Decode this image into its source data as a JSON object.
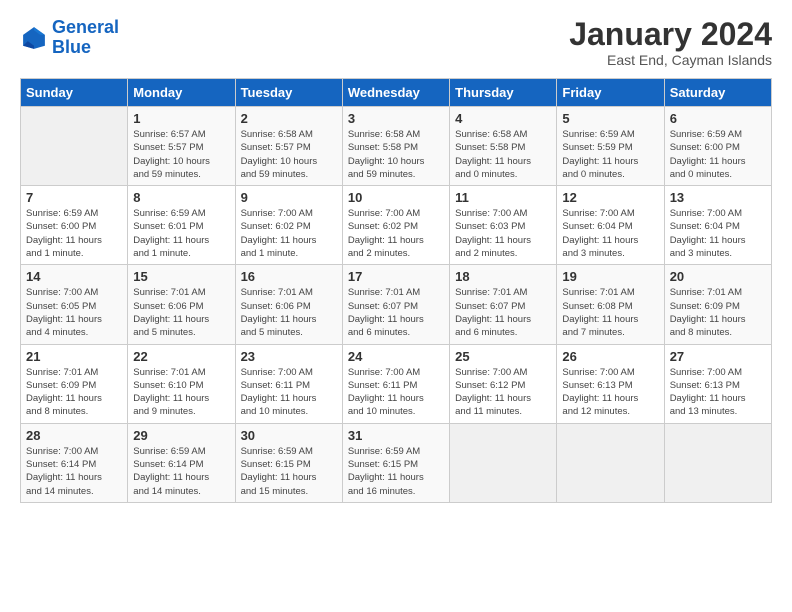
{
  "logo": {
    "line1": "General",
    "line2": "Blue"
  },
  "title": "January 2024",
  "subtitle": "East End, Cayman Islands",
  "days_of_week": [
    "Sunday",
    "Monday",
    "Tuesday",
    "Wednesday",
    "Thursday",
    "Friday",
    "Saturday"
  ],
  "weeks": [
    [
      {
        "day": "",
        "info": ""
      },
      {
        "day": "1",
        "info": "Sunrise: 6:57 AM\nSunset: 5:57 PM\nDaylight: 10 hours\nand 59 minutes."
      },
      {
        "day": "2",
        "info": "Sunrise: 6:58 AM\nSunset: 5:57 PM\nDaylight: 10 hours\nand 59 minutes."
      },
      {
        "day": "3",
        "info": "Sunrise: 6:58 AM\nSunset: 5:58 PM\nDaylight: 10 hours\nand 59 minutes."
      },
      {
        "day": "4",
        "info": "Sunrise: 6:58 AM\nSunset: 5:58 PM\nDaylight: 11 hours\nand 0 minutes."
      },
      {
        "day": "5",
        "info": "Sunrise: 6:59 AM\nSunset: 5:59 PM\nDaylight: 11 hours\nand 0 minutes."
      },
      {
        "day": "6",
        "info": "Sunrise: 6:59 AM\nSunset: 6:00 PM\nDaylight: 11 hours\nand 0 minutes."
      }
    ],
    [
      {
        "day": "7",
        "info": "Sunrise: 6:59 AM\nSunset: 6:00 PM\nDaylight: 11 hours\nand 1 minute."
      },
      {
        "day": "8",
        "info": "Sunrise: 6:59 AM\nSunset: 6:01 PM\nDaylight: 11 hours\nand 1 minute."
      },
      {
        "day": "9",
        "info": "Sunrise: 7:00 AM\nSunset: 6:02 PM\nDaylight: 11 hours\nand 1 minute."
      },
      {
        "day": "10",
        "info": "Sunrise: 7:00 AM\nSunset: 6:02 PM\nDaylight: 11 hours\nand 2 minutes."
      },
      {
        "day": "11",
        "info": "Sunrise: 7:00 AM\nSunset: 6:03 PM\nDaylight: 11 hours\nand 2 minutes."
      },
      {
        "day": "12",
        "info": "Sunrise: 7:00 AM\nSunset: 6:04 PM\nDaylight: 11 hours\nand 3 minutes."
      },
      {
        "day": "13",
        "info": "Sunrise: 7:00 AM\nSunset: 6:04 PM\nDaylight: 11 hours\nand 3 minutes."
      }
    ],
    [
      {
        "day": "14",
        "info": "Sunrise: 7:00 AM\nSunset: 6:05 PM\nDaylight: 11 hours\nand 4 minutes."
      },
      {
        "day": "15",
        "info": "Sunrise: 7:01 AM\nSunset: 6:06 PM\nDaylight: 11 hours\nand 5 minutes."
      },
      {
        "day": "16",
        "info": "Sunrise: 7:01 AM\nSunset: 6:06 PM\nDaylight: 11 hours\nand 5 minutes."
      },
      {
        "day": "17",
        "info": "Sunrise: 7:01 AM\nSunset: 6:07 PM\nDaylight: 11 hours\nand 6 minutes."
      },
      {
        "day": "18",
        "info": "Sunrise: 7:01 AM\nSunset: 6:07 PM\nDaylight: 11 hours\nand 6 minutes."
      },
      {
        "day": "19",
        "info": "Sunrise: 7:01 AM\nSunset: 6:08 PM\nDaylight: 11 hours\nand 7 minutes."
      },
      {
        "day": "20",
        "info": "Sunrise: 7:01 AM\nSunset: 6:09 PM\nDaylight: 11 hours\nand 8 minutes."
      }
    ],
    [
      {
        "day": "21",
        "info": "Sunrise: 7:01 AM\nSunset: 6:09 PM\nDaylight: 11 hours\nand 8 minutes."
      },
      {
        "day": "22",
        "info": "Sunrise: 7:01 AM\nSunset: 6:10 PM\nDaylight: 11 hours\nand 9 minutes."
      },
      {
        "day": "23",
        "info": "Sunrise: 7:00 AM\nSunset: 6:11 PM\nDaylight: 11 hours\nand 10 minutes."
      },
      {
        "day": "24",
        "info": "Sunrise: 7:00 AM\nSunset: 6:11 PM\nDaylight: 11 hours\nand 10 minutes."
      },
      {
        "day": "25",
        "info": "Sunrise: 7:00 AM\nSunset: 6:12 PM\nDaylight: 11 hours\nand 11 minutes."
      },
      {
        "day": "26",
        "info": "Sunrise: 7:00 AM\nSunset: 6:13 PM\nDaylight: 11 hours\nand 12 minutes."
      },
      {
        "day": "27",
        "info": "Sunrise: 7:00 AM\nSunset: 6:13 PM\nDaylight: 11 hours\nand 13 minutes."
      }
    ],
    [
      {
        "day": "28",
        "info": "Sunrise: 7:00 AM\nSunset: 6:14 PM\nDaylight: 11 hours\nand 14 minutes."
      },
      {
        "day": "29",
        "info": "Sunrise: 6:59 AM\nSunset: 6:14 PM\nDaylight: 11 hours\nand 14 minutes."
      },
      {
        "day": "30",
        "info": "Sunrise: 6:59 AM\nSunset: 6:15 PM\nDaylight: 11 hours\nand 15 minutes."
      },
      {
        "day": "31",
        "info": "Sunrise: 6:59 AM\nSunset: 6:15 PM\nDaylight: 11 hours\nand 16 minutes."
      },
      {
        "day": "",
        "info": ""
      },
      {
        "day": "",
        "info": ""
      },
      {
        "day": "",
        "info": ""
      }
    ]
  ]
}
